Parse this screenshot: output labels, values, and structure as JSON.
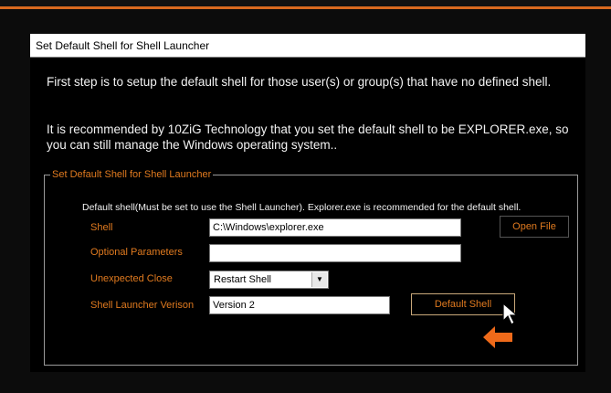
{
  "dialog": {
    "title": "Set Default Shell for Shell Launcher",
    "message1": "First step is to setup the default shell for those user(s) or group(s) that have no defined shell.",
    "message2": "It is recommended by 10ZiG Technology that you set the default shell to be EXPLORER.exe, so you can still manage the Windows operating system.."
  },
  "group": {
    "legend": "Set Default Shell for Shell Launcher",
    "hint": "Default shell(Must be set to use the Shell Launcher). Explorer.exe is recommended for the default shell.",
    "shell_label": "Shell",
    "shell_value": "C:\\Windows\\explorer.exe",
    "open_file_label": "Open File",
    "optional_params_label": "Optional Parameters",
    "optional_params_value": "",
    "unexpected_close_label": "Unexpected Close",
    "unexpected_close_value": "Restart Shell",
    "version_label": "Shell Launcher Verison",
    "version_value": "Version 2",
    "default_shell_button": "Default Shell"
  },
  "colors": {
    "accent": "#e07a1f",
    "background": "#000000",
    "text": "#f2f2f2"
  },
  "icons": {
    "cursor": "mouse-pointer-icon",
    "arrow": "orange-left-arrow-icon",
    "dropdown": "chevron-down-icon"
  }
}
